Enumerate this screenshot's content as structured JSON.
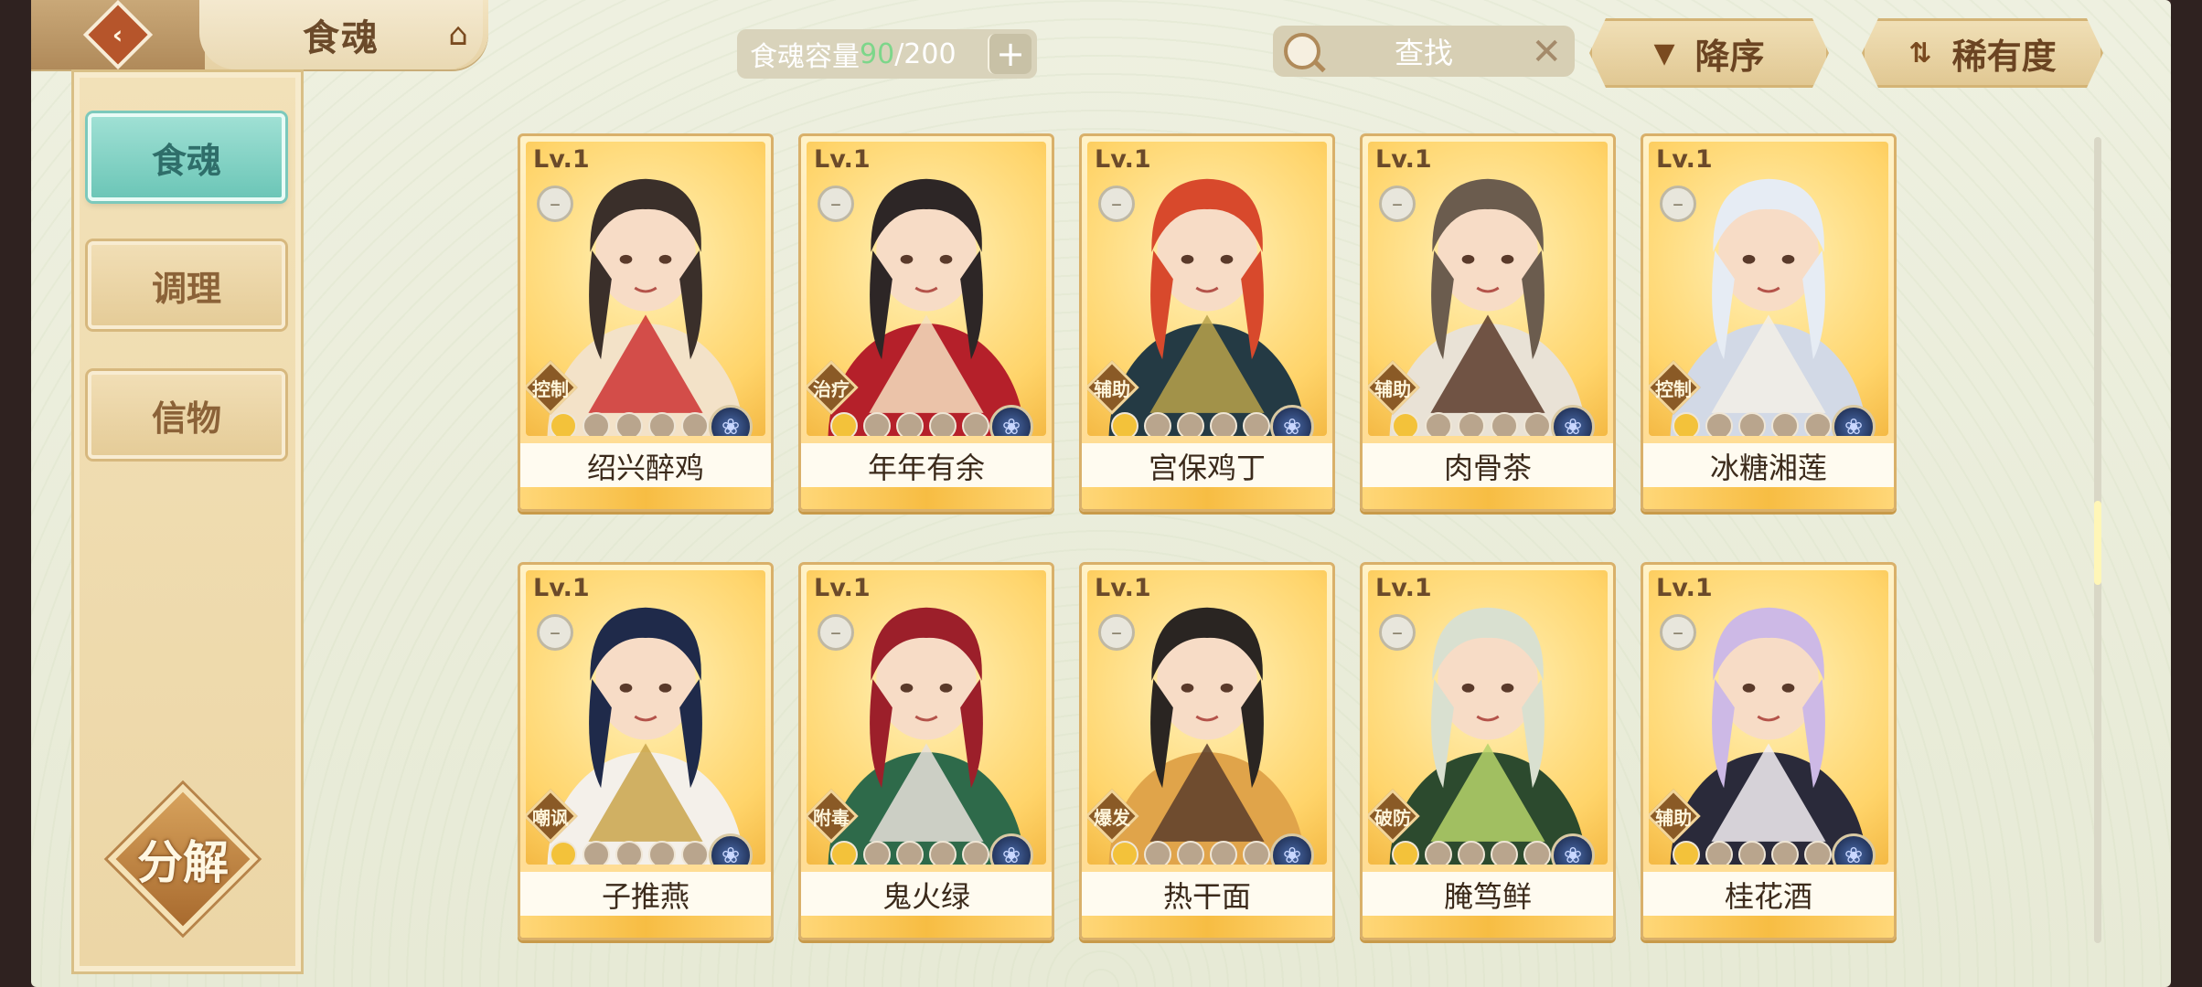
{
  "header": {
    "back_label": "‹",
    "title": "食魂",
    "home_icon": "pavilion-icon"
  },
  "capacity": {
    "label": "食魂容量 ",
    "current": "90",
    "max": "/200",
    "plus": "+"
  },
  "search": {
    "placeholder": "查找",
    "clear": "✕"
  },
  "sort": {
    "order_label": "降序",
    "order_icon": "▼",
    "rarity_label": "稀有度",
    "rarity_icon": "⇅"
  },
  "sidebar": {
    "items": [
      {
        "label": "食魂"
      },
      {
        "label": "调理"
      },
      {
        "label": "信物"
      }
    ],
    "decompose_label": "分解"
  },
  "cards": [
    {
      "level": "Lv.1",
      "role": "控制",
      "name": "绍兴醉鸡",
      "stars_on": 1
    },
    {
      "level": "Lv.1",
      "role": "治疗",
      "name": "年年有余",
      "stars_on": 1
    },
    {
      "level": "Lv.1",
      "role": "辅助",
      "name": "宫保鸡丁",
      "stars_on": 1
    },
    {
      "level": "Lv.1",
      "role": "辅助",
      "name": "肉骨茶",
      "stars_on": 1
    },
    {
      "level": "Lv.1",
      "role": "控制",
      "name": "冰糖湘莲",
      "stars_on": 1
    },
    {
      "level": "Lv.1",
      "role": "嘲讽",
      "name": "子推燕",
      "stars_on": 1
    },
    {
      "level": "Lv.1",
      "role": "附毒",
      "name": "鬼火绿",
      "stars_on": 1
    },
    {
      "level": "Lv.1",
      "role": "爆发",
      "name": "热干面",
      "stars_on": 1
    },
    {
      "level": "Lv.1",
      "role": "破防",
      "name": "腌笃鲜",
      "stars_on": 1
    },
    {
      "level": "Lv.1",
      "role": "辅助",
      "name": "桂花酒",
      "stars_on": 1
    }
  ],
  "colors": {
    "accent_teal": "#6cc6b7",
    "capacity_current": "#7dd68a",
    "card_gold": "#ffd46a"
  }
}
